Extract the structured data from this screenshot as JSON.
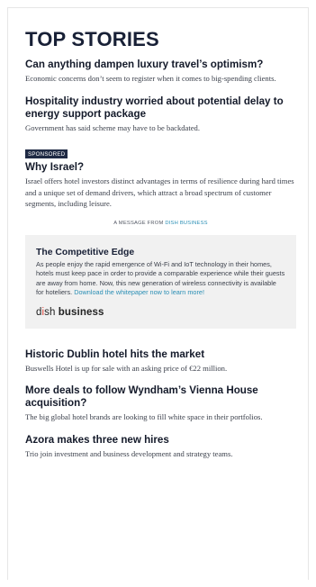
{
  "section": {
    "title": "TOP STORIES"
  },
  "stories_top": [
    {
      "headline": "Can anything dampen luxury travel’s optimism?",
      "dek": "Economic concerns don’t seem to register when it comes to big-spending clients."
    },
    {
      "headline": "Hospitality industry worried about potential delay to energy support package",
      "dek": "Government has said scheme may have to be backdated."
    }
  ],
  "sponsored": {
    "badge": "SPONSORED",
    "headline": "Why Israel?",
    "dek": "Israel offers hotel investors distinct advantages in terms of resilience during hard times and a unique set of demand drivers, which attract a broad spectrum of customer segments, including leisure."
  },
  "message": {
    "label_prefix": "A MESSAGE FROM ",
    "brand": "DISH BUSINESS"
  },
  "promo": {
    "title": "The Competitive Edge",
    "body": "As people enjoy the rapid emergence of Wi-Fi and IoT technology in their homes, hotels must keep pace in order to provide a comparable experience while their guests are away from home. Now, this new generation of wireless connectivity is available for hoteliers. ",
    "link": "Download the whitepaper now to learn more!",
    "logo": {
      "d": "d",
      "i": "i",
      "sh": "sh",
      "business": " business"
    }
  },
  "stories_bottom": [
    {
      "headline": "Historic Dublin hotel hits the market",
      "dek": "Buswells Hotel is up for sale with an asking price of €22 million."
    },
    {
      "headline": "More deals to follow Wyndham’s Vienna House acquisition?",
      "dek": "The big global hotel brands are looking to fill white space in their portfolios."
    },
    {
      "headline": "Azora makes three new hires",
      "dek": "Trio join investment and business development and strategy teams."
    }
  ],
  "colors": {
    "badge_bg": "#1f2a44",
    "link": "#2b8fb5",
    "logo_accent": "#e0453a",
    "promo_bg": "#f1f1f1"
  }
}
